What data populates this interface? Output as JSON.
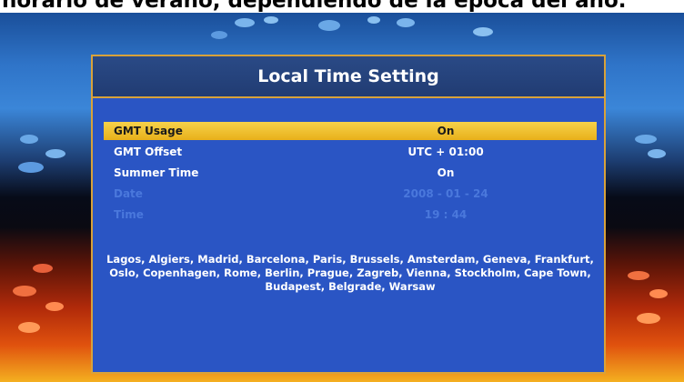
{
  "caption": "horario de verano, dependiendo de la época del año.",
  "dialog": {
    "title": "Local Time Setting",
    "rows": [
      {
        "label": "GMT Usage",
        "value": "On"
      },
      {
        "label": "GMT Offset",
        "value": "UTC + 01:00"
      },
      {
        "label": "Summer Time",
        "value": "On"
      },
      {
        "label": "Date",
        "value": "2008 - 01 - 24"
      },
      {
        "label": "Time",
        "value": "19 : 44"
      }
    ],
    "selected_row": "GMT Usage",
    "disabled_rows": [
      "Date",
      "Time"
    ],
    "cities": "Lagos, Algiers, Madrid, Barcelona, Paris, Brussels, Amsterdam, Geneva, Frankfurt, Oslo, Copenhagen, Rome, Berlin, Prague, Zagreb, Vienna, Stockholm, Cape Town, Budapest, Belgrade, Warsaw"
  },
  "colors": {
    "dialog_bg": "#2a55c4",
    "header_bg": "#213c73",
    "border": "#d8a23a",
    "highlight": "#f0c030",
    "disabled_text": "#4a78dc"
  }
}
